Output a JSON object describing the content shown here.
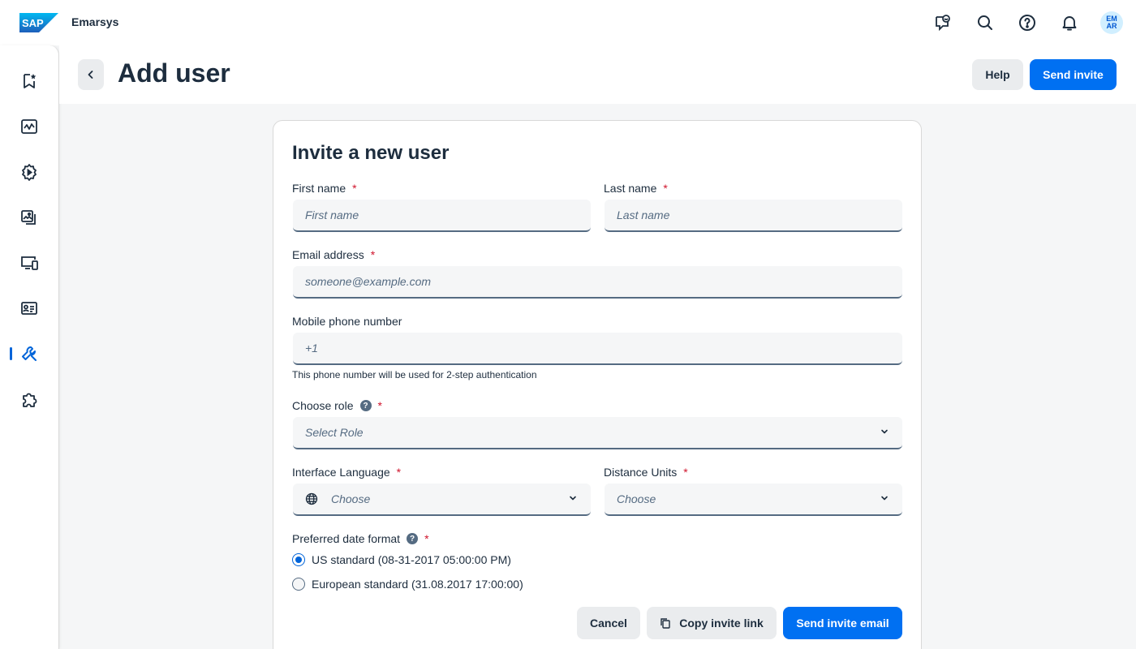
{
  "shell": {
    "brand": "Emarsys",
    "avatar_initials_1": "EM",
    "avatar_initials_2": "AR",
    "actions": [
      "feedback-icon",
      "search-icon",
      "help-icon",
      "bell-icon"
    ]
  },
  "sidenav": {
    "items": [
      "bookmark-star-icon",
      "analytics-icon",
      "automation-icon",
      "content-icon",
      "channels-icon",
      "contacts-icon",
      "management-icon",
      "addons-icon"
    ],
    "active_index": 6
  },
  "header": {
    "title": "Add user",
    "help_label": "Help",
    "send_label": "Send invite"
  },
  "form": {
    "title": "Invite a new user",
    "first_name": {
      "label": "First name",
      "placeholder": "First name"
    },
    "last_name": {
      "label": "Last name",
      "placeholder": "Last name"
    },
    "email": {
      "label": "Email address",
      "placeholder": "someone@example.com"
    },
    "phone": {
      "label": "Mobile phone number",
      "placeholder": "+1",
      "hint": "This phone number will be used for 2-step authentication"
    },
    "role": {
      "label": "Choose role",
      "placeholder": "Select Role"
    },
    "language": {
      "label": "Interface Language",
      "placeholder": "Choose"
    },
    "distance": {
      "label": "Distance Units",
      "placeholder": "Choose"
    },
    "date_format": {
      "label": "Preferred date format",
      "options": [
        "US standard (08-31-2017 05:00:00 PM)",
        "European standard (31.08.2017 17:00:00)"
      ],
      "selected": 0
    },
    "required_mark": "*",
    "help_mark": "?",
    "cancel_label": "Cancel",
    "copy_label": "Copy invite link",
    "send_email_label": "Send invite email"
  },
  "colors": {
    "accent": "#0070f2",
    "required": "#d0152d",
    "text": "#1d2d3e"
  }
}
